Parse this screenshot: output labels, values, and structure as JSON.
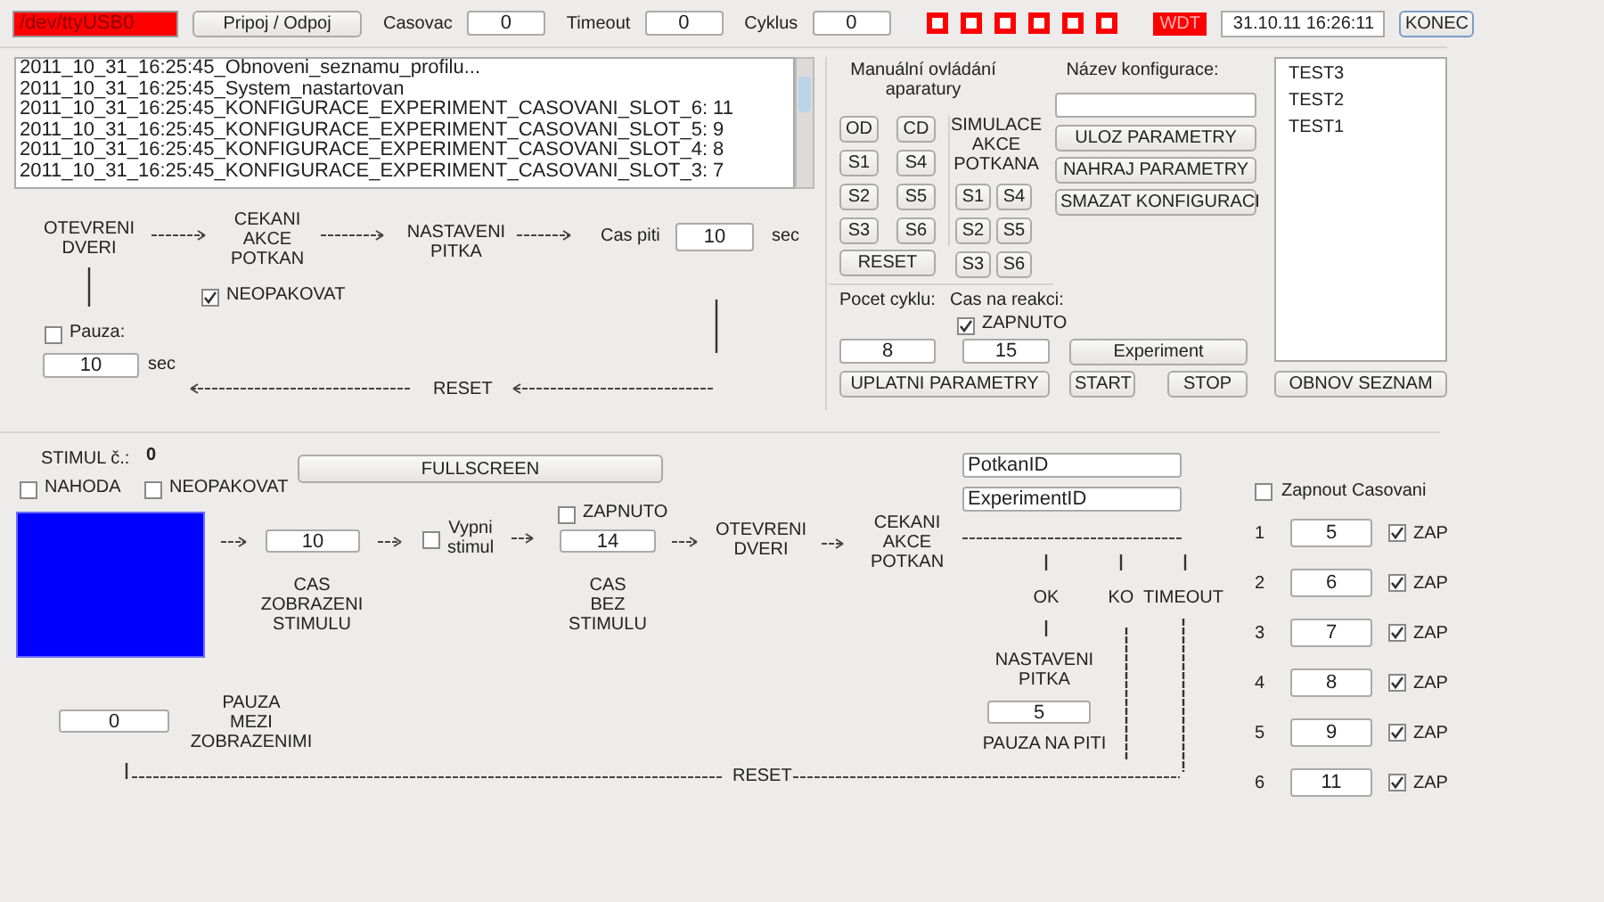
{
  "toolbar": {
    "port": {
      "value": "/dev/ttyUSB0",
      "error": true
    },
    "connect_button": "Pripoj / Odpoj",
    "counters": [
      {
        "label": "Casovac",
        "value": "0"
      },
      {
        "label": "Timeout",
        "value": "0"
      },
      {
        "label": "Cyklus",
        "value": "0"
      }
    ],
    "indicators": [
      {
        "lit": true
      },
      {
        "lit": true
      },
      {
        "lit": true
      },
      {
        "lit": true
      },
      {
        "lit": true
      },
      {
        "lit": true
      }
    ],
    "watchdog": {
      "label": "WDT",
      "alarm": true
    },
    "datetime": "31.10.11  16:26:11",
    "quit_button": "KONEC"
  },
  "log": {
    "lines": [
      "2011_10_31_16:25:45_Obnoveni_seznamu_profilu...",
      "2011_10_31_16:25:45_System_nastartovan",
      "2011_10_31_16:25:45_KONFIGURACE_EXPERIMENT_CASOVANI_SLOT_6: 11",
      "2011_10_31_16:25:45_KONFIGURACE_EXPERIMENT_CASOVANI_SLOT_5: 9",
      "2011_10_31_16:25:45_KONFIGURACE_EXPERIMENT_CASOVANI_SLOT_4: 8",
      "2011_10_31_16:25:45_KONFIGURACE_EXPERIMENT_CASOVANI_SLOT_3: 7"
    ]
  },
  "manual": {
    "title": "Manuální ovládání\naparatury",
    "buttons": [
      "OD",
      "CD",
      "S1",
      "S4",
      "S2",
      "S5",
      "S3",
      "S6"
    ],
    "reset_button": "RESET"
  },
  "simulation": {
    "title": "SIMULACE\nAKCE\nPOTKANA",
    "buttons": [
      "S1",
      "S4",
      "S2",
      "S5",
      "S3",
      "S6"
    ]
  },
  "configuration": {
    "label": "Název konfigurace:",
    "buttons": [
      "ULOZ PARAMETRY",
      "NAHRAJ PARAMETRY",
      "SMAZAT KONFIGURACI"
    ]
  },
  "profiles": {
    "items": [
      {
        "label": "TEST3",
        "selected": false
      },
      {
        "label": "TEST2",
        "selected": false
      },
      {
        "label": "TEST1",
        "selected": false
      }
    ],
    "refresh_button": "OBNOV SEZNAM"
  },
  "cycles": {
    "count_label": "Pocet cyklu:",
    "count": "8",
    "reaction_label": "Cas na reakci:",
    "reaction_enabled": {
      "label": "ZAPNUTO",
      "checked": true
    },
    "reaction_time": "15",
    "experiment_button": "Experiment",
    "apply_button": "UPLATNI PARAMETRY",
    "start_button": "START",
    "stop_button": "STOP"
  },
  "drink_flow": {
    "nodes": [
      "OTEVRENI\nDVERI",
      "CEKANI\nAKCE\nPOTKAN",
      "NASTAVENI\nPITKA"
    ],
    "drink_label": "Cas piti",
    "drink_time": "10",
    "drink_unit": "sec",
    "no_repeat": {
      "label": "NEOPAKOVAT",
      "checked": true
    },
    "pause": {
      "label": "Pauza:",
      "checked": false
    },
    "pause_time": "10",
    "pause_unit": "sec",
    "reset": "RESET"
  },
  "stimulus_flow": {
    "stimulus_label": "STIMUL č.:",
    "stimulus_number": "0",
    "random": {
      "label": "NAHODA",
      "checked": false
    },
    "no_repeat": {
      "label": "NEOPAKOVAT",
      "checked": false
    },
    "fullscreen_button": "FULLSCREEN",
    "display_time": "10",
    "display_label": "CAS\nZOBRAZENI\nSTIMULU",
    "stimulus_off": {
      "label": "Vypni\nstimul",
      "checked": false
    },
    "blank_enabled": {
      "label": "ZAPNUTO",
      "checked": false
    },
    "blank_time": "14",
    "blank_label": "CAS\nBEZ\nSTIMULU",
    "nodes": [
      "OTEVRENI\nDVERI",
      "CEKANI\nAKCE\nPOTKAN"
    ],
    "rat_id": "PotkanID",
    "experiment_id": "ExperimentID",
    "outcomes": [
      "OK",
      "KO",
      "TIMEOUT"
    ],
    "drink_node": "NASTAVENI\nPITKA",
    "drink_pause": "5",
    "drink_pause_label": "PAUZA NA PITI",
    "display_pause": "0",
    "display_pause_label": "PAUZA\nMEZI\nZOBRAZENIMI",
    "reset": "RESET"
  },
  "timing": {
    "toggle": {
      "label": "Zapnout Casovani",
      "checked": false
    },
    "slots": [
      {
        "number": "1",
        "value": "5",
        "label": "ZAP",
        "checked": true
      },
      {
        "number": "2",
        "value": "6",
        "label": "ZAP",
        "checked": true
      },
      {
        "number": "3",
        "value": "7",
        "label": "ZAP",
        "checked": true
      },
      {
        "number": "4",
        "value": "8",
        "label": "ZAP",
        "checked": true
      },
      {
        "number": "5",
        "value": "9",
        "label": "ZAP",
        "checked": true
      },
      {
        "number": "6",
        "value": "11",
        "label": "ZAP",
        "checked": true
      }
    ]
  }
}
